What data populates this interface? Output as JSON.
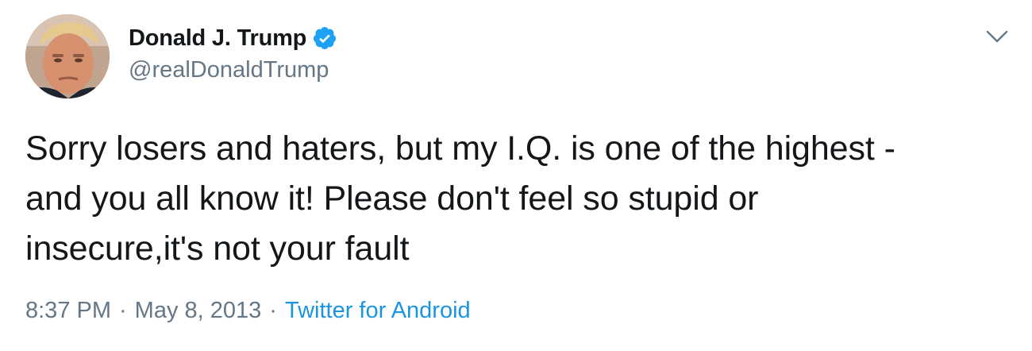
{
  "user": {
    "display_name": "Donald J. Trump",
    "handle": "@realDonaldTrump",
    "verified": true,
    "avatar_icon": "profile-photo"
  },
  "tweet": {
    "text": "Sorry losers and haters, but my I.Q. is one of the highest -\nand you all know it! Please don't feel so stupid or\ninsecure,it's not your fault"
  },
  "meta": {
    "time": "8:37 PM",
    "separator": "·",
    "date": "May 8, 2013",
    "source": "Twitter for Android"
  },
  "icons": {
    "verified": "verified-badge-icon",
    "menu": "chevron-down-icon"
  },
  "colors": {
    "text_primary": "#14171a",
    "text_secondary": "#657786",
    "link": "#1b95e0",
    "verified": "#1da1f2"
  }
}
